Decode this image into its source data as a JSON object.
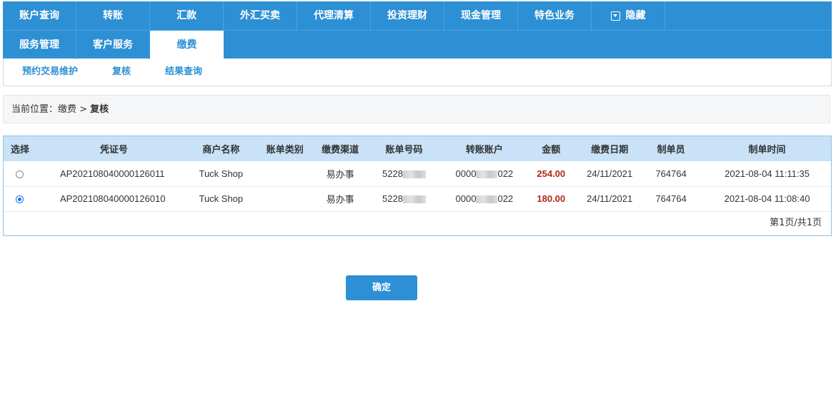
{
  "nav": {
    "row1": [
      "账户查询",
      "转账",
      "汇款",
      "外汇买卖",
      "代理清算",
      "投资理财",
      "现金管理",
      "特色业务"
    ],
    "hide_label": "隐藏",
    "row2": [
      "服务管理",
      "客户服务",
      "缴费"
    ],
    "active": "缴费"
  },
  "subnav": [
    "预约交易维护",
    "复核",
    "结果查询"
  ],
  "breadcrumb": {
    "prefix": "当前位置：缴费 > ",
    "current": "复核"
  },
  "table": {
    "headers": [
      "选择",
      "凭证号",
      "商户名称",
      "账单类别",
      "缴费渠道",
      "账单号码",
      "转账账户",
      "金额",
      "缴费日期",
      "制单员",
      "制单时间"
    ],
    "rows": [
      {
        "selected": false,
        "voucher": "AP202108040000126011",
        "merchant": "Tuck Shop",
        "bill_type": "",
        "channel": "易办事",
        "bill_no_prefix": "5228",
        "account_prefix": "0000",
        "account_suffix": "022",
        "amount": "254.00",
        "pay_date": "24/11/2021",
        "operator": "764764",
        "created": "2021-08-04 11:11:35"
      },
      {
        "selected": true,
        "voucher": "AP202108040000126010",
        "merchant": "Tuck Shop",
        "bill_type": "",
        "channel": "易办事",
        "bill_no_prefix": "5228",
        "account_prefix": "0000",
        "account_suffix": "022",
        "amount": "180.00",
        "pay_date": "24/11/2021",
        "operator": "764764",
        "created": "2021-08-04 11:08:40"
      }
    ],
    "pager": "第1页/共1页"
  },
  "confirm_label": "确定",
  "colors": {
    "nav_blue": "#2d8fd4",
    "amount_red": "#b02a14",
    "header_bg": "#c9e2f7"
  }
}
